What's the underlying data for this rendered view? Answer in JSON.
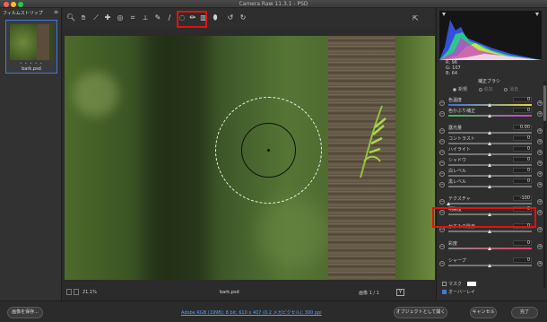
{
  "window": {
    "title": "Camera Raw 11.3.1  -  PSD"
  },
  "filmstrip": {
    "title": "フィルムストリップ",
    "menu_icon": "≡",
    "file_name": "bark.psd",
    "dots": "• • • • •"
  },
  "toolbar": {
    "tools": [
      "zoom-icon",
      "hand-icon",
      "white-balance-icon",
      "color-sampler-icon",
      "targeted-adjust-icon",
      "crop-icon",
      "straighten-icon",
      "spot-removal-icon",
      "red-eye-icon",
      "adjustment-brush-icon",
      "graduated-filter-icon",
      "radial-filter-icon",
      "preferences-icon",
      "rotate-left-icon",
      "rotate-right-icon"
    ],
    "export_icon": "export-icon"
  },
  "status": {
    "zoom": "21.1%",
    "file_name": "bark.psd",
    "image_count": "画像 1 / 1",
    "view_mode": "Y"
  },
  "bottom": {
    "save_label": "画像を保存...",
    "workflow_label": "Adobe RGB (1998); 8 bit; 610 x 407 (0.2 メガピクセル); 300 ppi",
    "open_object_label": "オブジェクトとして開く",
    "cancel_label": "キャンセル",
    "done_label": "完了"
  },
  "right_panel": {
    "rgb": {
      "r_label": "R:",
      "r": "96",
      "g_label": "G:",
      "g": "107",
      "b_label": "B:",
      "b": "64"
    },
    "panel_title": "補正ブラシ",
    "modes": [
      "新規",
      "追加",
      "消去"
    ],
    "sliders": [
      {
        "label": "色温度",
        "value": "0"
      },
      {
        "label": "色かぶり補正",
        "value": "0"
      },
      {
        "label": "露光量",
        "value": "0.00"
      },
      {
        "label": "コントラスト",
        "value": "0"
      },
      {
        "label": "ハイライト",
        "value": "0"
      },
      {
        "label": "シャドウ",
        "value": "0"
      },
      {
        "label": "白レベル",
        "value": "0"
      },
      {
        "label": "黒レベル",
        "value": "0"
      },
      {
        "label": "テクスチャ",
        "value": "-100"
      },
      {
        "label": "明瞭度",
        "value": "0"
      },
      {
        "label": "かすみの除去",
        "value": "0"
      },
      {
        "label": "彩度",
        "value": "0"
      },
      {
        "label": "シャープ",
        "value": "0"
      }
    ],
    "mask_label": "マスク",
    "overlay_label": "オーバーレイ",
    "overlay_checked": true,
    "mask_checked": false
  },
  "colors": {
    "accent": "#3d7bd6",
    "highlight": "#e21111",
    "link": "#5aa0f0"
  }
}
